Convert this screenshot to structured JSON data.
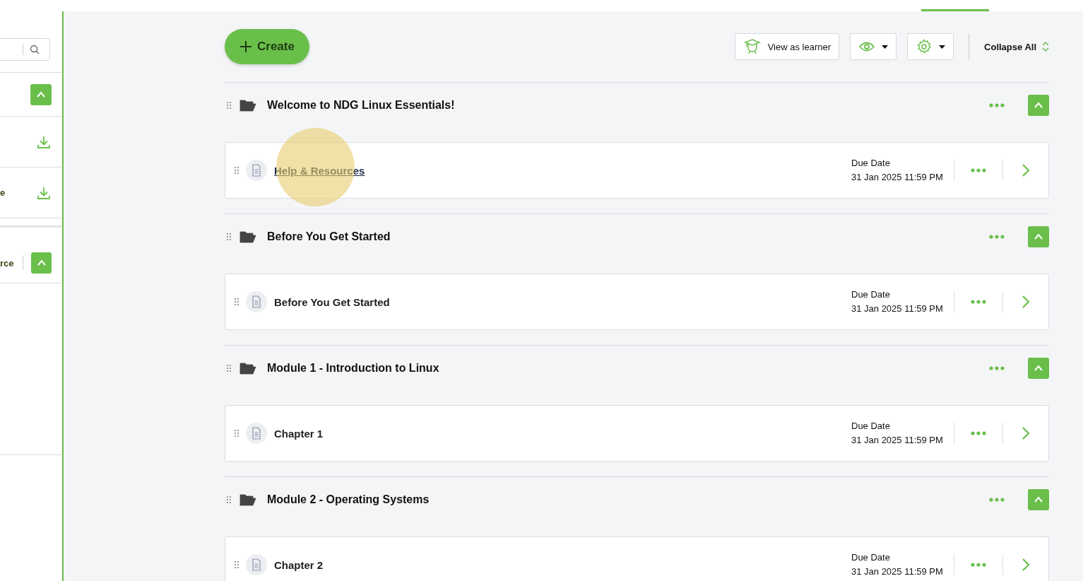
{
  "sidebar": {
    "rows": [
      {
        "kind": "collapse",
        "text": ""
      },
      {
        "kind": "download",
        "text": ""
      },
      {
        "kind": "download",
        "text": "e"
      },
      {
        "kind": "collapse",
        "text": "rce"
      }
    ]
  },
  "toolbar": {
    "create": "Create",
    "view_as_learner": "View as learner",
    "collapse_all": "Collapse All"
  },
  "sections": [
    {
      "title": "Welcome to NDG Linux Essentials!",
      "expanded": true,
      "items": [
        {
          "title": "Help & Resources",
          "link": true,
          "due_label": "Due Date",
          "due_date": "31 Jan 2025 11:59 PM"
        }
      ]
    },
    {
      "title": "Before You Get Started",
      "expanded": true,
      "items": [
        {
          "title": "Before You Get Started",
          "link": false,
          "due_label": "Due Date",
          "due_date": "31 Jan 2025 11:59 PM"
        }
      ]
    },
    {
      "title": "Module 1 - Introduction to Linux",
      "expanded": true,
      "items": [
        {
          "title": "Chapter 1",
          "link": false,
          "due_label": "Due Date",
          "due_date": "31 Jan 2025 11:59 PM"
        }
      ]
    },
    {
      "title": "Module 2 - Operating Systems",
      "expanded": true,
      "items": [
        {
          "title": "Chapter 2",
          "link": false,
          "due_label": "Due Date",
          "due_date": "31 Jan 2025 11:59 PM"
        }
      ]
    }
  ]
}
